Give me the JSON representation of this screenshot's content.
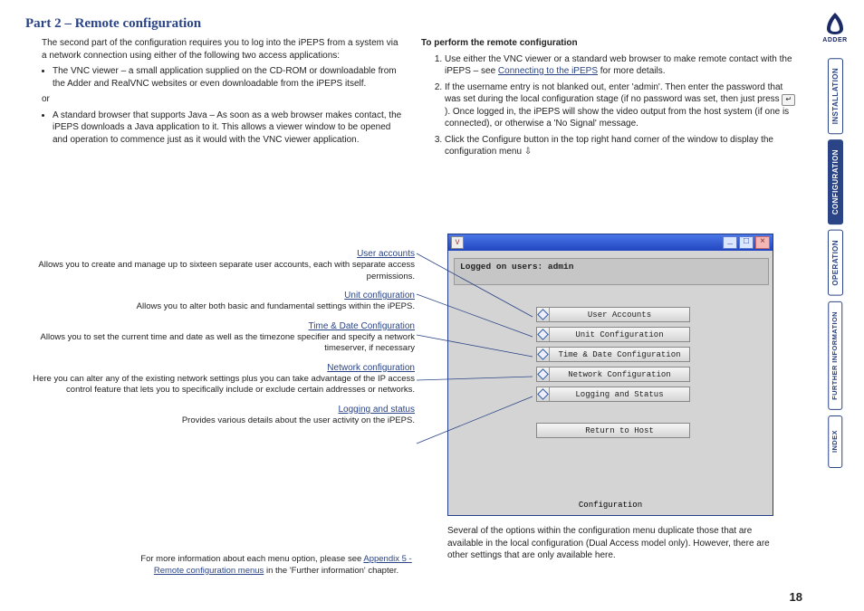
{
  "page_number": "18",
  "title": "Part 2 – Remote configuration",
  "intro": "The second part of the configuration requires you to log into the iPEPS from a system via a network connection using either of the following two access applications:",
  "bullet_vnc": "The VNC viewer – a small application supplied on the CD-ROM or downloadable from the Adder and RealVNC websites or even downloadable from the iPEPS itself.",
  "or": "or",
  "bullet_browser": "A standard browser that supports Java – As soon as a web browser makes contact, the iPEPS downloads a Java application to it. This allows a viewer window to be opened and operation to commence just as it would with the VNC viewer application.",
  "perform_heading": "To perform the remote configuration",
  "step1_a": "Use either the VNC viewer or a standard web browser to make remote contact with the iPEPS – see ",
  "step1_link": "Connecting to the iPEPS",
  "step1_b": " for more details.",
  "step2_a": "If the username entry is not blanked out, enter 'admin'. Then enter the password that was set during the local configuration stage (if no password was set, then just press ",
  "step2_key": "↵",
  "step2_b": "). Once logged in, the iPEPS will show the video output from the host system (if one is connected), or otherwise a 'No Signal' message.",
  "step3": "Click the Configure button in the top right hand corner of the window to display the configuration menu ⇩",
  "callouts": [
    {
      "title": "User accounts",
      "desc": "Allows you to create and manage up to sixteen separate user accounts, each with separate access permissions."
    },
    {
      "title": "Unit configuration",
      "desc": "Allows you to alter both basic and fundamental settings within the iPEPS."
    },
    {
      "title": "Time & Date Configuration",
      "desc": "Allows you to set the current time and date as well as the timezone specifier and specify a network timeserver, if necessary"
    },
    {
      "title": "Network configuration",
      "desc": "Here you can alter any of the existing network settings plus you can take advantage of the IP access control feature that lets you to specifically include or exclude certain addresses or networks."
    },
    {
      "title": "Logging and status",
      "desc": "Provides various details about the user activity on the iPEPS."
    }
  ],
  "moreinfo_a": "For more information about each menu option, please see ",
  "moreinfo_link": "Appendix 5 - Remote configuration menus",
  "moreinfo_b": " in the 'Further information' chapter.",
  "note_below": "Several of the options within the configuration menu duplicate those that are available in the local configuration (Dual Access model only). However, there are other settings that are only available here.",
  "vnc": {
    "logged_on": "Logged on users: admin",
    "buttons": [
      "User Accounts",
      "Unit Configuration",
      "Time & Date Configuration",
      "Network Configuration",
      "Logging and Status"
    ],
    "return": "Return to Host",
    "footer": "Configuration"
  },
  "brand": "ADDER",
  "sidebar": {
    "installation": "INSTALLATION",
    "configuration": "CONFIGURATION",
    "operation": "OPERATION",
    "further": "FURTHER INFORMATION",
    "index": "INDEX"
  }
}
